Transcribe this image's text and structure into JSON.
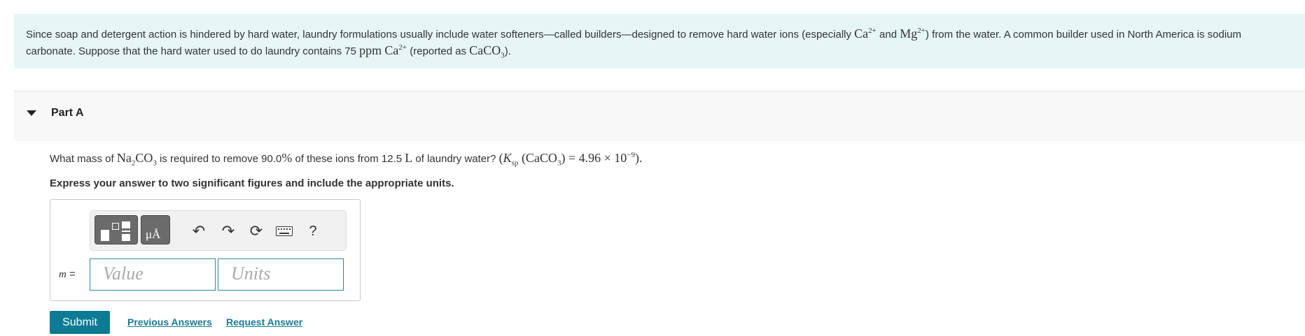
{
  "intro": {
    "t1": "Since soap and detergent action is hindered by hard water, laundry formulations usually include water softeners—called builders—designed to remove hard water ions (especially ",
    "ca": "Ca",
    "ca_charge": "2+",
    "and": " and ",
    "mg": "Mg",
    "mg_charge": "2+",
    "t2": ") from the water. A common builder used in North America is sodium carbonate. Suppose that the hard water used to do laundry contains 75 ",
    "ppm": "ppm",
    "ca2": "Ca",
    "ca2_charge": "2+",
    "t3": " (reported as ",
    "caco3": "CaCO",
    "caco3_sub": "3",
    "t4": ")."
  },
  "part": {
    "title": "Part A"
  },
  "question": {
    "q1": "What mass of ",
    "na": "Na",
    "na_sub": "2",
    "co": "CO",
    "co_sub": "3",
    "q2": " is required to remove 90.0",
    "pct": "%",
    "q3": " of these ions from 12.5 ",
    "L": "L",
    "q4": " of laundry water? ",
    "ksp_open": "(",
    "K": "K",
    "sp": "sp",
    "ksp_rest": " (CaCO",
    "ksp_sub": "3",
    "ksp_eq": ") = 4.96 × 10",
    "ksp_exp": "−9",
    "ksp_close": ").",
    "instruction": "Express your answer to two significant figures and include the appropriate units."
  },
  "answer": {
    "variable": "m",
    "equals": " =",
    "value_placeholder": "Value",
    "units_placeholder": "Units",
    "units_button": "μÅ",
    "help": "?"
  },
  "actions": {
    "submit": "Submit",
    "previous_answers": "Previous Answers",
    "request_answer": "Request Answer"
  },
  "icons": {
    "templates": "templates-icon",
    "units": "units-icon",
    "undo": "undo-icon",
    "redo": "redo-icon",
    "reset": "reset-icon",
    "keyboard": "keyboard-icon",
    "help": "help-icon"
  },
  "colors": {
    "intro_bg": "#e6f5f6",
    "accent": "#0d7b93",
    "link": "#1a7c94",
    "field_border": "#2a8aa0"
  }
}
